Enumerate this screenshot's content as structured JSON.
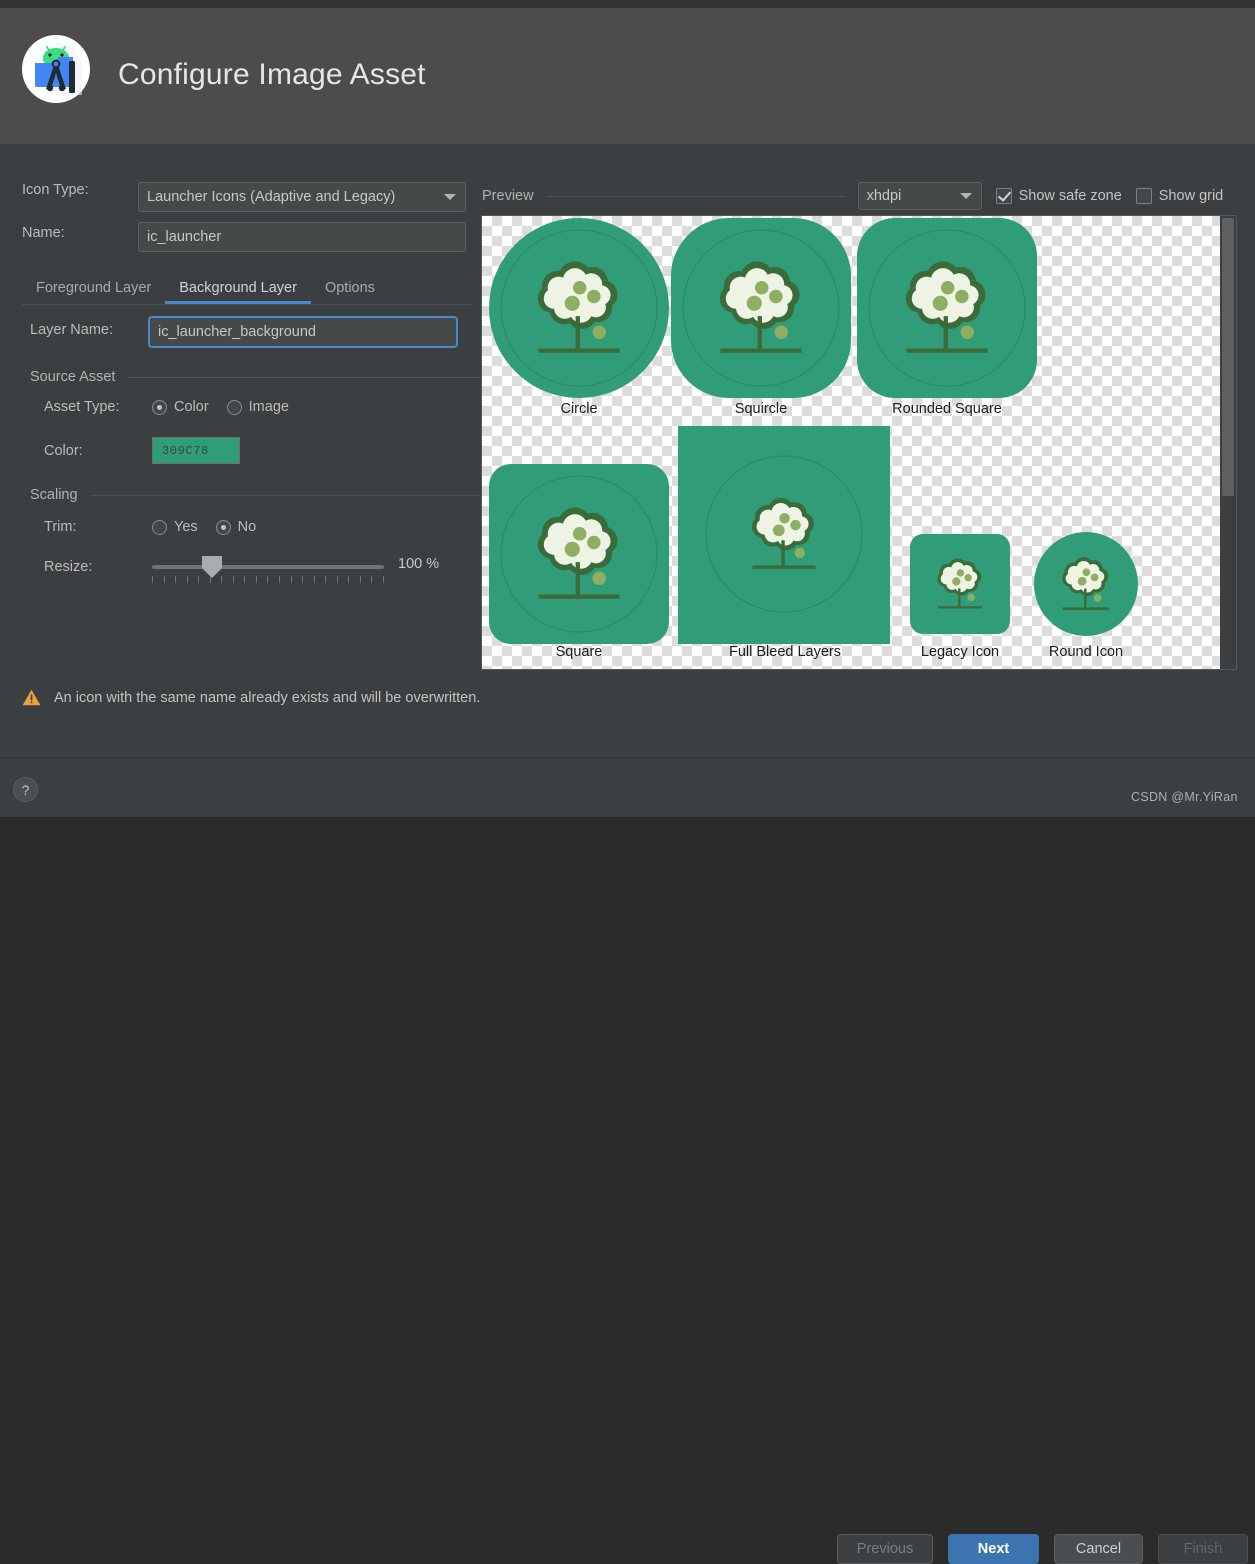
{
  "window": {
    "title": "Configure Image Asset",
    "logo_icon": "android-studio-icon"
  },
  "form": {
    "icon_type_label": "Icon Type:",
    "icon_type_value": "Launcher Icons (Adaptive and Legacy)",
    "name_label": "Name:",
    "name_value": "ic_launcher",
    "tabs": [
      {
        "label": "Foreground Layer",
        "active": false
      },
      {
        "label": "Background Layer",
        "active": true
      },
      {
        "label": "Options",
        "active": false
      }
    ],
    "layer_name_label": "Layer Name:",
    "layer_name_value": "ic_launcher_background",
    "source_asset_group": "Source Asset",
    "asset_type_label": "Asset Type:",
    "asset_type_options": [
      "Color",
      "Image"
    ],
    "asset_type_selected": "Color",
    "color_label": "Color:",
    "color_value": "309C78",
    "color_hex": "#309C78",
    "scaling_group": "Scaling",
    "trim_label": "Trim:",
    "trim_options": [
      "Yes",
      "No"
    ],
    "trim_selected": "No",
    "resize_label": "Resize:",
    "resize_value": "100 %",
    "resize_percent": 100
  },
  "preview": {
    "title": "Preview",
    "density_value": "xhdpi",
    "show_safe_zone_label": "Show safe zone",
    "show_safe_zone_checked": true,
    "show_grid_label": "Show grid",
    "show_grid_checked": false,
    "items": [
      {
        "caption": "Circle"
      },
      {
        "caption": "Squircle"
      },
      {
        "caption": "Rounded Square"
      },
      {
        "caption": "Square"
      },
      {
        "caption": "Full Bleed Layers"
      },
      {
        "caption": "Legacy Icon"
      },
      {
        "caption": "Round Icon"
      }
    ],
    "icon_colors": {
      "background": "#309C78",
      "outline": "#3B6B3A",
      "canopy": "#EDF4E4",
      "dot": "#8FAE63",
      "ground": "#3B6B3A"
    }
  },
  "warning": {
    "icon": "warning-triangle-icon",
    "text": "An icon with the same name already exists and will be overwritten.",
    "color": "#E8A33D"
  },
  "footer": {
    "help_label": "?",
    "previous_label": "Previous",
    "next_label": "Next",
    "cancel_label": "Cancel",
    "finish_label": "Finish",
    "accent_color": "#3C74B0"
  },
  "watermark": {
    "text": "CSDN @Mr.YiRan"
  }
}
